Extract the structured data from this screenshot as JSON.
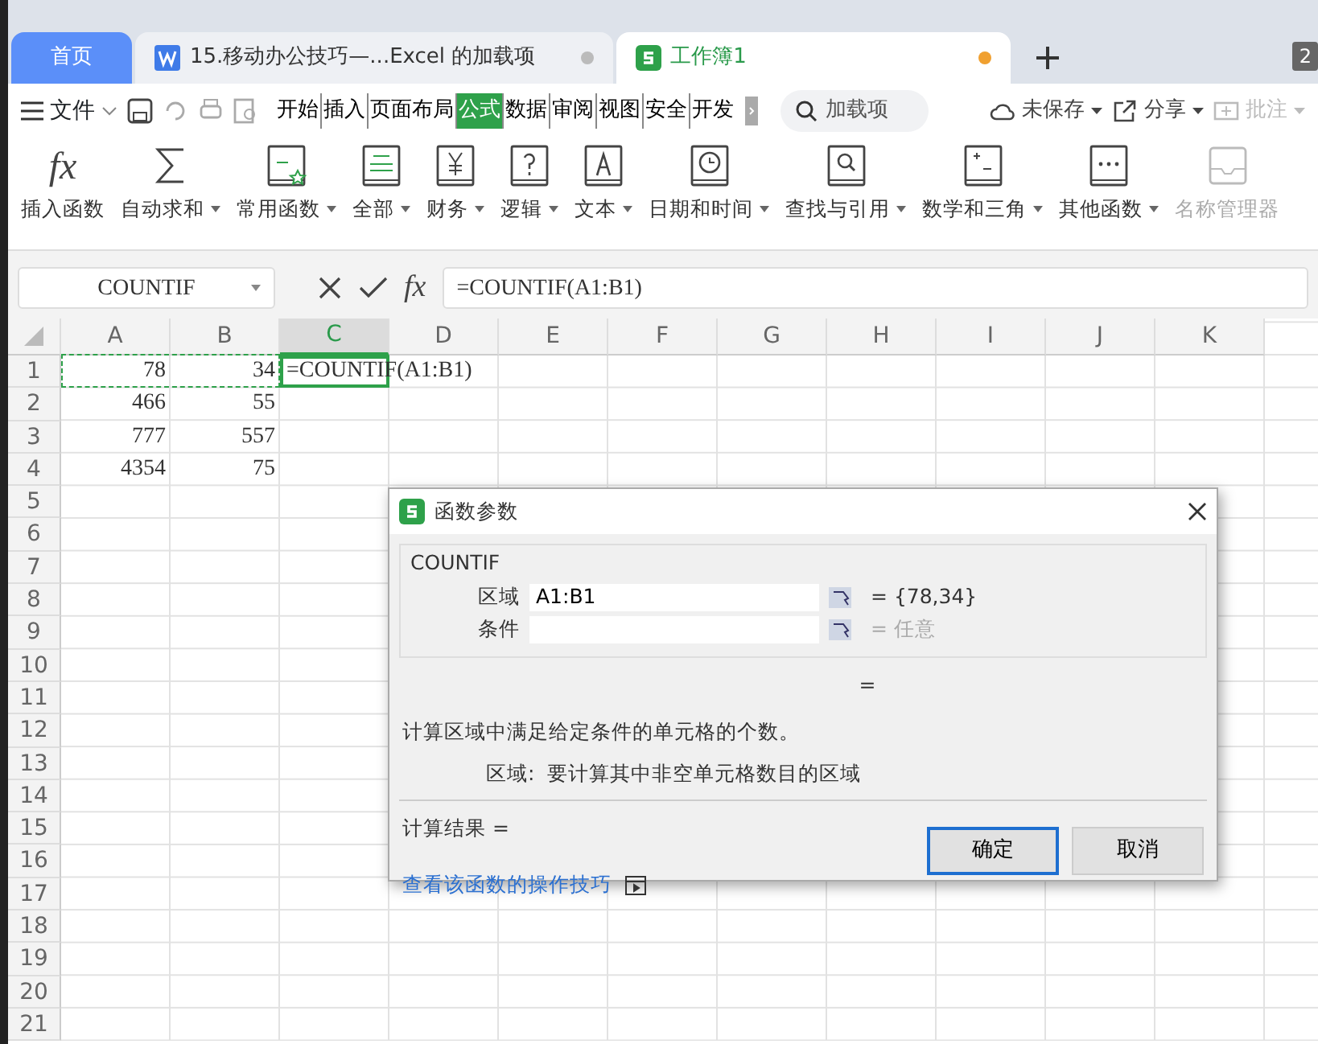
{
  "tabs": [
    {
      "label": "首页",
      "kind": "home",
      "selected": false
    },
    {
      "label": "15.移动办公技巧—...Excel 的加载项",
      "kind": "doc",
      "selected": false,
      "unsaved": false
    },
    {
      "label": "工作簿1",
      "kind": "sheet",
      "selected": true,
      "unsaved": true
    }
  ],
  "window_count": "2",
  "menu": {
    "file": "文件",
    "ribbon_tabs": [
      {
        "label": "开始",
        "selected": false
      },
      {
        "label": "插入",
        "selected": false
      },
      {
        "label": "页面布局",
        "selected": false
      },
      {
        "label": "公式",
        "selected": true
      },
      {
        "label": "数据",
        "selected": false
      },
      {
        "label": "审阅",
        "selected": false
      },
      {
        "label": "视图",
        "selected": false
      },
      {
        "label": "安全",
        "selected": false
      },
      {
        "label": "开发",
        "selected": false
      }
    ],
    "search_placeholder": "加载项",
    "actions": [
      {
        "label": "未保存",
        "kind": "cloud",
        "disabled": false
      },
      {
        "label": "分享",
        "kind": "share",
        "disabled": false
      },
      {
        "label": "批注",
        "kind": "comment",
        "disabled": true
      }
    ]
  },
  "ribbon": [
    {
      "label": "插入函数",
      "kind": "fx",
      "icon_text": "fx",
      "dropdown": false,
      "disabled": false
    },
    {
      "label": "自动求和",
      "kind": "sum",
      "dropdown": true,
      "disabled": false
    },
    {
      "label": "常用函数",
      "kind": "star",
      "dropdown": true,
      "disabled": false
    },
    {
      "label": "全部",
      "kind": "fxbook",
      "dropdown": true,
      "disabled": false
    },
    {
      "label": "财务",
      "kind": "yen",
      "dropdown": true,
      "disabled": false
    },
    {
      "label": "逻辑",
      "kind": "question",
      "dropdown": true,
      "disabled": false
    },
    {
      "label": "文本",
      "kind": "text",
      "dropdown": true,
      "disabled": false
    },
    {
      "label": "日期和时间",
      "kind": "clock",
      "dropdown": true,
      "disabled": false
    },
    {
      "label": "查找与引用",
      "kind": "search",
      "dropdown": true,
      "disabled": false
    },
    {
      "label": "数学和三角",
      "kind": "math",
      "dropdown": true,
      "disabled": false
    },
    {
      "label": "其他函数",
      "kind": "dots",
      "dropdown": true,
      "disabled": false
    },
    {
      "label": "名称管理器",
      "kind": "tray",
      "dropdown": false,
      "disabled": true
    }
  ],
  "formula_bar": {
    "name_box": "COUNTIF",
    "fx_label": "fx",
    "formula": "=COUNTIF(A1:B1)"
  },
  "sheet": {
    "columns": [
      {
        "label": "A",
        "selected": false
      },
      {
        "label": "B",
        "selected": false
      },
      {
        "label": "C",
        "selected": true
      },
      {
        "label": "D",
        "selected": false
      },
      {
        "label": "E",
        "selected": false
      },
      {
        "label": "F",
        "selected": false
      },
      {
        "label": "G",
        "selected": false
      },
      {
        "label": "H",
        "selected": false
      },
      {
        "label": "I",
        "selected": false
      },
      {
        "label": "J",
        "selected": false
      },
      {
        "label": "K",
        "selected": false
      }
    ],
    "rows": [
      {
        "label": "1",
        "cells": [
          "78",
          "34",
          "=COUNTIF(A1:B1)"
        ]
      },
      {
        "label": "2",
        "cells": [
          "466",
          "55"
        ]
      },
      {
        "label": "3",
        "cells": [
          "777",
          "557"
        ]
      },
      {
        "label": "4",
        "cells": [
          "4354",
          "75"
        ]
      },
      {
        "label": "5"
      },
      {
        "label": "6"
      },
      {
        "label": "7"
      },
      {
        "label": "8"
      },
      {
        "label": "9"
      },
      {
        "label": "10"
      },
      {
        "label": "11"
      },
      {
        "label": "12"
      },
      {
        "label": "13"
      },
      {
        "label": "14"
      },
      {
        "label": "15"
      },
      {
        "label": "16"
      },
      {
        "label": "17"
      },
      {
        "label": "18"
      },
      {
        "label": "19"
      },
      {
        "label": "20"
      },
      {
        "label": "21"
      }
    ]
  },
  "dialog": {
    "title": "函数参数",
    "function_name": "COUNTIF",
    "args": [
      {
        "label": "区域",
        "value": "A1:B1",
        "result": "= {78,34}",
        "muted": false
      },
      {
        "label": "条件",
        "result": "= 任意",
        "muted": true
      }
    ],
    "equals": "=",
    "description": "计算区域中满足给定条件的单元格的个数。",
    "arg_help_label": "区域:",
    "arg_help": "要计算其中非空单元格数目的区域",
    "result_label": "计算结果 =",
    "link": "查看该函数的操作技巧",
    "buttons": [
      {
        "label": "确定",
        "default": true
      },
      {
        "label": "取消",
        "default": false
      }
    ]
  }
}
